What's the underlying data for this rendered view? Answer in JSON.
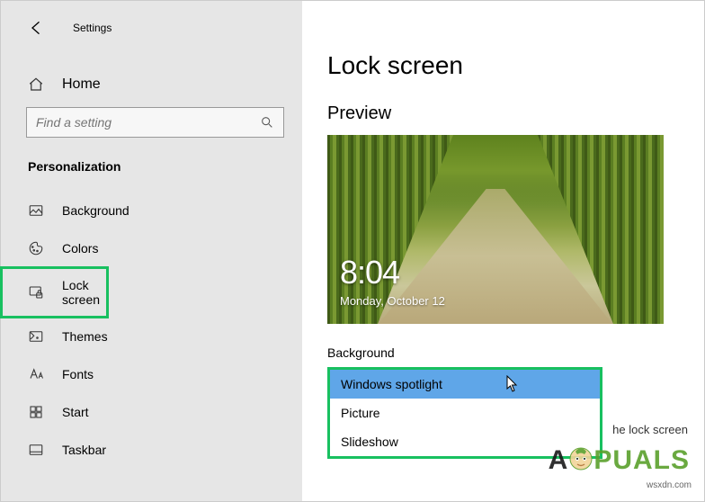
{
  "header": {
    "app_title": "Settings"
  },
  "sidebar": {
    "home_label": "Home",
    "search_placeholder": "Find a setting",
    "category": "Personalization",
    "items": [
      {
        "label": "Background"
      },
      {
        "label": "Colors"
      },
      {
        "label": "Lock screen"
      },
      {
        "label": "Themes"
      },
      {
        "label": "Fonts"
      },
      {
        "label": "Start"
      },
      {
        "label": "Taskbar"
      }
    ]
  },
  "main": {
    "page_title": "Lock screen",
    "preview_title": "Preview",
    "lock_time": "8:04",
    "lock_date": "Monday, October 12",
    "background_label": "Background",
    "dropdown": {
      "options": [
        {
          "label": "Windows spotlight",
          "selected": true
        },
        {
          "label": "Picture"
        },
        {
          "label": "Slideshow"
        }
      ]
    },
    "fragment_text": "he lock screen"
  },
  "watermark": {
    "brand_pre": "A",
    "brand_post": "PUALS",
    "attribution": "wsxdn.com"
  }
}
